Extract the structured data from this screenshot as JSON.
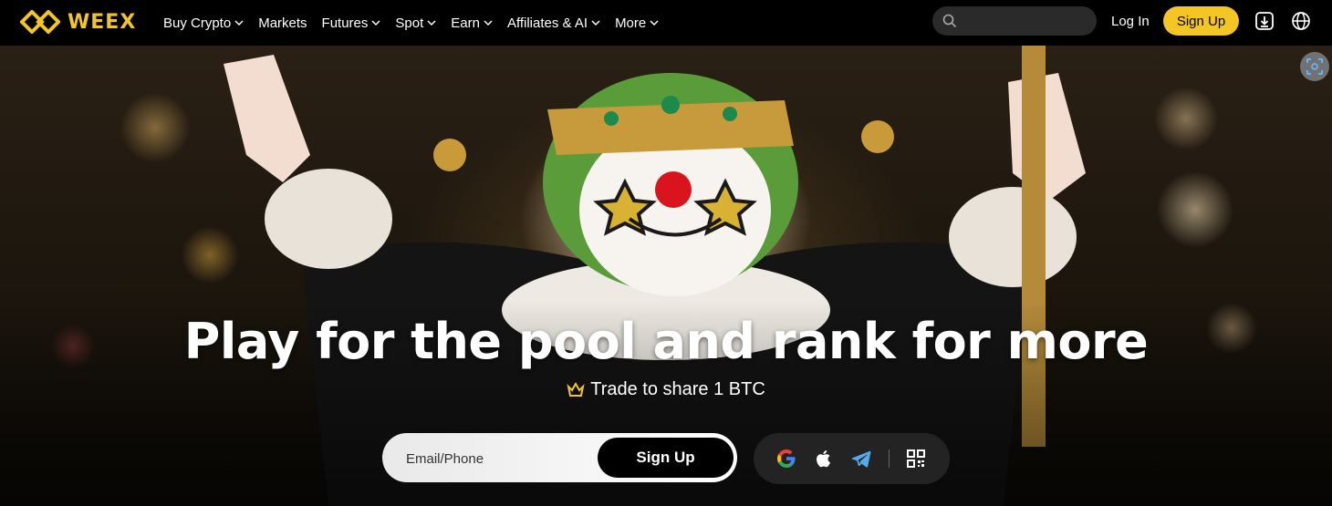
{
  "brand": {
    "name": "WEEX",
    "color": "#f3c623"
  },
  "nav": {
    "items": [
      {
        "label": "Buy Crypto",
        "dropdown": true
      },
      {
        "label": "Markets",
        "dropdown": false
      },
      {
        "label": "Futures",
        "dropdown": true
      },
      {
        "label": "Spot",
        "dropdown": true
      },
      {
        "label": "Earn",
        "dropdown": true
      },
      {
        "label": "Affiliates & AI",
        "dropdown": true
      },
      {
        "label": "More",
        "dropdown": true
      }
    ],
    "search_icon": "search-icon",
    "login_label": "Log In",
    "signup_label": "Sign Up",
    "download_icon": "download-icon",
    "language_icon": "globe-icon"
  },
  "hero": {
    "headline": "Play for the pool and rank for more",
    "subline": "Trade to share 1 BTC",
    "subline_icon": "crown-icon",
    "form": {
      "input_placeholder": "Email/Phone",
      "button_label": "Sign Up"
    },
    "social": [
      "google-icon",
      "apple-icon",
      "telegram-icon",
      "qr-code-icon"
    ],
    "scan_icon": "scan-icon"
  }
}
